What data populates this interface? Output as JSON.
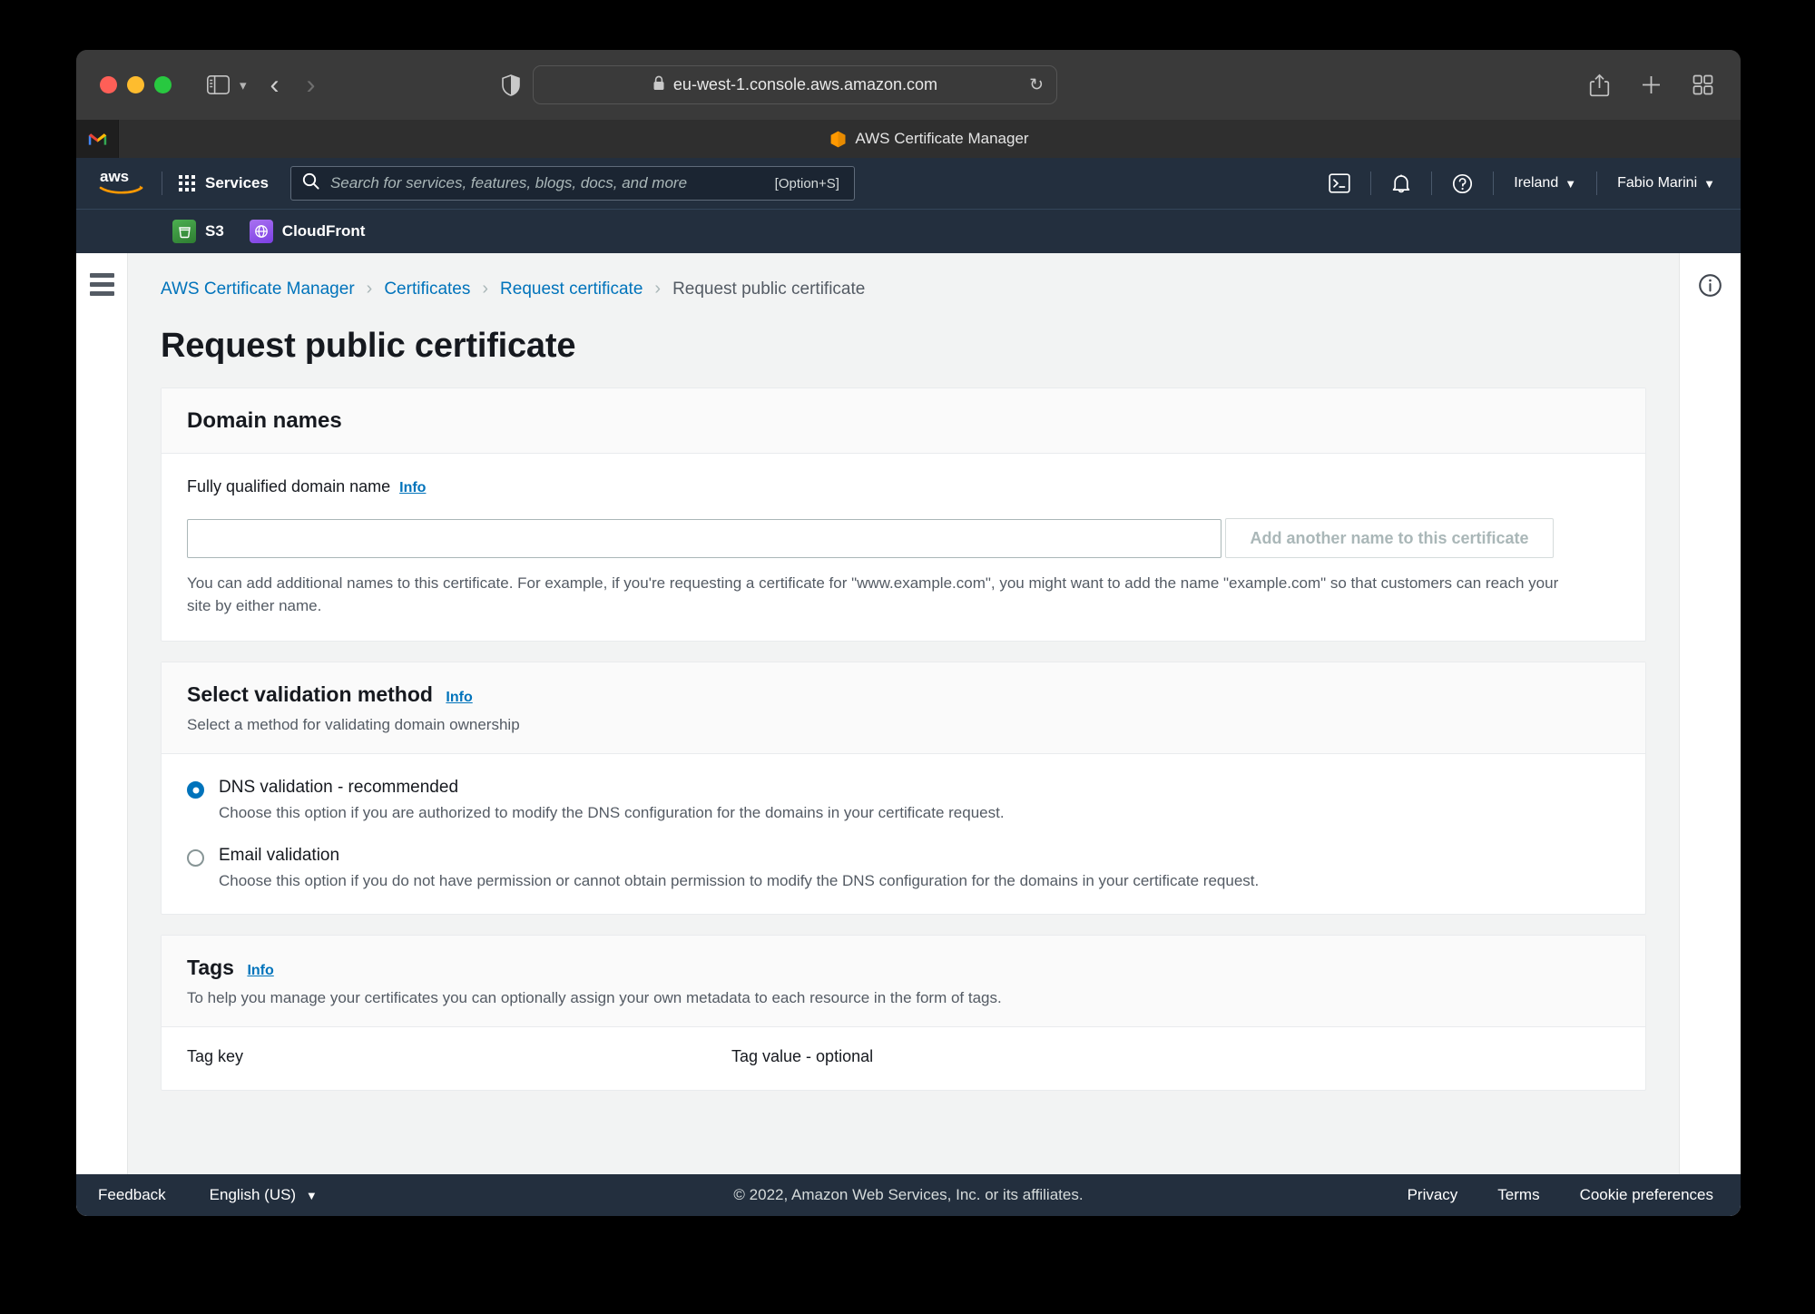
{
  "browser": {
    "url": "eu-west-1.console.aws.amazon.com",
    "tab_title": "AWS Certificate Manager",
    "icons": {
      "sidebar": "sidebar-icon",
      "sidebar_chevron": "chevron-down-icon",
      "back": "back-chevron-icon",
      "forward": "forward-chevron-icon",
      "shield": "privacy-shield-icon",
      "lock": "lock-icon",
      "reload": "reload-icon",
      "share": "share-icon",
      "new_tab": "plus-icon",
      "tab_overview": "tab-grid-icon",
      "pinned_tab": "gmail-icon"
    }
  },
  "aws_nav": {
    "logo_label": "aws",
    "services_label": "Services",
    "search_placeholder": "Search for services, features, blogs, docs, and more",
    "search_shortcut": "[Option+S]",
    "cloudshell_icon": "cloudshell-icon",
    "notifications_icon": "bell-icon",
    "help_icon": "question-circle-icon",
    "region": "Ireland",
    "account": "Fabio Marini",
    "caret": "▼"
  },
  "favorites": [
    {
      "label": "S3",
      "icon": "s3-bucket-icon"
    },
    {
      "label": "CloudFront",
      "icon": "cloudfront-globe-icon"
    }
  ],
  "breadcrumb": {
    "items": [
      {
        "label": "AWS Certificate Manager",
        "current": false
      },
      {
        "label": "Certificates",
        "current": false
      },
      {
        "label": "Request certificate",
        "current": false
      },
      {
        "label": "Request public certificate",
        "current": true
      }
    ],
    "separator": "›"
  },
  "page": {
    "title": "Request public certificate"
  },
  "domain_names": {
    "heading": "Domain names",
    "field_label": "Fully qualified domain name",
    "info_label": "Info",
    "input_value": "",
    "input_placeholder": "",
    "add_button_label": "Add another name to this certificate",
    "help_text": "You can add additional names to this certificate. For example, if you're requesting a certificate for \"www.example.com\", you might want to add the name \"example.com\" so that customers can reach your site by either name."
  },
  "validation": {
    "heading": "Select validation method",
    "info_label": "Info",
    "subtitle": "Select a method for validating domain ownership",
    "options": [
      {
        "label": "DNS validation - recommended",
        "description": "Choose this option if you are authorized to modify the DNS configuration for the domains in your certificate request.",
        "selected": true
      },
      {
        "label": "Email validation",
        "description": "Choose this option if you do not have permission or cannot obtain permission to modify the DNS configuration for the domains in your certificate request.",
        "selected": false
      }
    ]
  },
  "tags": {
    "heading": "Tags",
    "info_label": "Info",
    "subtitle": "To help you manage your certificates you can optionally assign your own metadata to each resource in the form of tags.",
    "column_key": "Tag key",
    "column_value": "Tag value - optional"
  },
  "rails": {
    "menu_icon": "hamburger-menu-icon",
    "info_icon": "info-circle-icon"
  },
  "footer": {
    "feedback": "Feedback",
    "language": "English (US)",
    "language_caret": "▼",
    "copyright": "© 2022, Amazon Web Services, Inc. or its affiliates.",
    "privacy": "Privacy",
    "terms": "Terms",
    "cookies": "Cookie preferences"
  },
  "colors": {
    "aws_navy": "#232f3e",
    "aws_link": "#0073bb",
    "aws_orange": "#ff9900",
    "page_bg": "#f2f3f3"
  }
}
